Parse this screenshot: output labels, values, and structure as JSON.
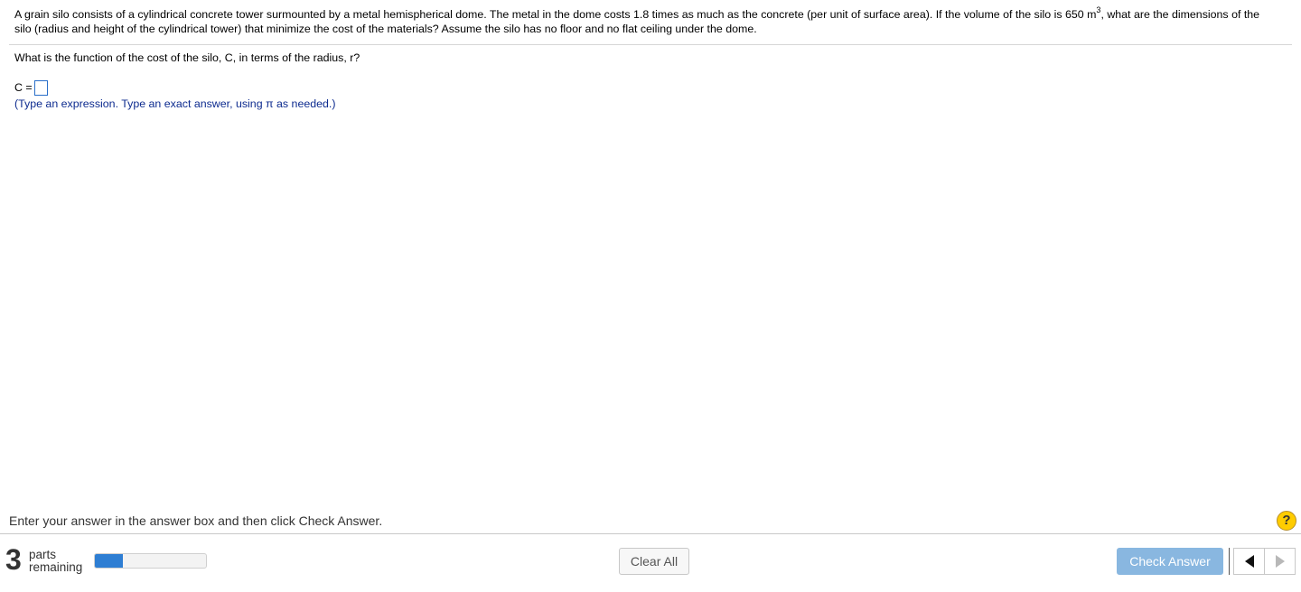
{
  "question": {
    "text_before_exponent": "A grain silo consists of a cylindrical concrete tower surmounted by a metal hemispherical dome. The metal in the dome costs 1.8 times as much as the concrete (per unit of surface area). If the volume of the silo is 650 m",
    "exponent": "3",
    "text_after_exponent": ", what are the dimensions of the silo (radius and height of the cylindrical tower) that minimize the cost of the materials? Assume the silo has no floor and no flat ceiling under the dome."
  },
  "sub_question": "What is the function of the cost of the silo, C, in terms of the radius, r?",
  "answer": {
    "label": "C =",
    "value": ""
  },
  "hint": "(Type an expression. Type an exact answer, using π as needed.)",
  "footer": {
    "instruction": "Enter your answer in the answer box and then click Check Answer.",
    "help_symbol": "?",
    "parts_count": "3",
    "parts_label_line1": "parts",
    "parts_label_line2": "remaining",
    "progress_fraction": 0.25,
    "clear_all_label": "Clear All",
    "check_answer_label": "Check Answer",
    "accent_color": "#2e7ed3",
    "help_color": "#ffcc00",
    "prev_icon": "triangle-left-icon",
    "next_icon": "triangle-right-icon"
  }
}
